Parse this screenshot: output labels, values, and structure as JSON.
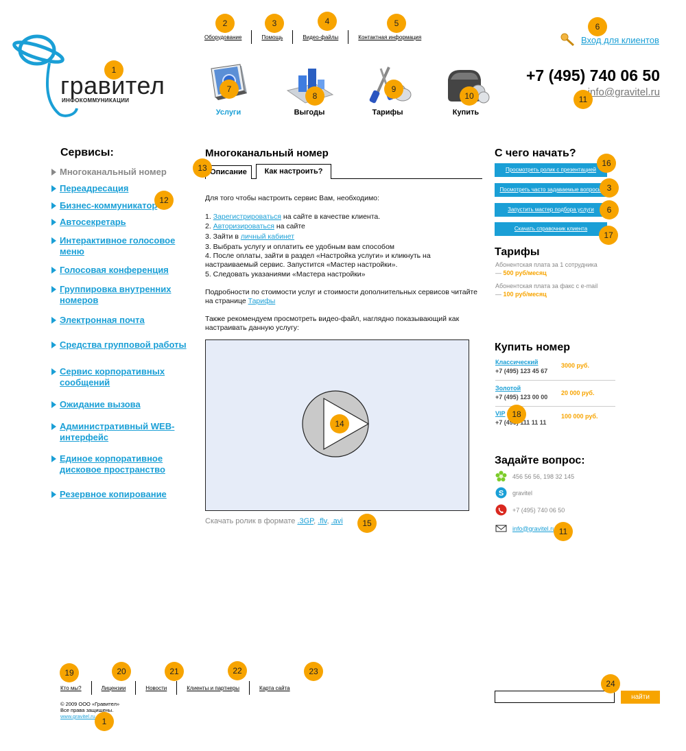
{
  "top_nav": [
    "Оборудование",
    "Помощь",
    "Видео-файлы",
    "Контактная информация"
  ],
  "logo": {
    "word": "гравител",
    "sub": "ИНФОКОММУНИКАЦИИ"
  },
  "login_label": "Вход для клиентов",
  "phone": "+7 (495) 740 06 50",
  "email_top": "info@gravitel.ru",
  "main_nav": [
    "Услуги",
    "Выгоды",
    "Тарифы",
    "Купить"
  ],
  "sidebar": {
    "title": "Сервисы:",
    "items": [
      "Многоканальный номер",
      "Переадресация",
      "Бизнес-коммуникатор",
      "Автосекретарь",
      "Интерактивное голосовое меню",
      "Голосовая конференция",
      "Группировка внутренних номеров",
      "Электронная почта",
      "Средства групповой работы",
      "Сервис корпоративных сообщений",
      "Ожидание вызова",
      "Административный WEB-интерфейс",
      "Единое корпоративное дисковое пространство",
      "Резервное копирование"
    ]
  },
  "main": {
    "title": "Многоканальный номер",
    "tabs": [
      "Описание",
      "Как настроить?"
    ],
    "intro": "Для того чтобы настроить сервис Вам, необходимо:",
    "step1_num": "1.",
    "step1_link": "Зарегистрироваться",
    "step1_rest": "на сайте в качестве клиента.",
    "step2_num": "2.",
    "step2_link": "Авторизироваться",
    "step2_rest": "на сайте",
    "step3_text": "3. Зайти в",
    "step3_link": "личный кабинет",
    "step4": "3. Выбрать услугу и оплатить ее удобным вам способом",
    "step5": "4. После оплаты, зайти в раздел «Настройка услуги» и кликнуть на настраиваемый сервис. Запустится «Мастер настройки».",
    "step6": "5. Следовать указаниями «Мастера настройки»",
    "details": "Подробности по стоимости услуг и стоимости дополнительных сервисов читайте на странице",
    "details_link": "Тарифы",
    "video_text": "Также рекомендуем просмотреть видео-файл, наглядно показывающий как настраивать данную услугу:",
    "download_label": "Скачать ролик в формате",
    "formats": [
      ".3GP",
      ".flv",
      ".avi"
    ]
  },
  "right": {
    "start_title": "С чего начать?",
    "start_buttons": [
      "Просмотреть ролик с презентацией",
      "Посмотреть часто задаваемые вопросы",
      "Запустить мастер подбора услуги",
      "Скачать справочник клиента"
    ],
    "tariffs_title": "Тарифы",
    "tariff1_label": "Абонентская плата за 1 сотрудника",
    "tariff1_dash": "—",
    "tariff1_price": "500 руб/месяц",
    "tariff2_label": "Абонентская плата за факс с e-mail",
    "tariff2_dash": "—",
    "tariff2_price": "100 руб/месяц",
    "buy_title": "Купить номер",
    "numbers": [
      {
        "name": "Классический",
        "phone": "+7 (495) 123 45 67",
        "price": "3000 руб."
      },
      {
        "name": "Золотой",
        "phone": "+7 (495) 123 00 00",
        "price": "20 000 руб."
      },
      {
        "name": "VIP",
        "phone": "+7 (495) 111 11 11",
        "price": "100 000 руб."
      }
    ],
    "ask_title": "Задайте вопрос:",
    "icq": "456 56 56, 198 32 145",
    "skype": "gravitel",
    "phone": "+7 (495) 740 06 50",
    "email": "info@gravitel.ru"
  },
  "footer": {
    "nav": [
      "Кто мы?",
      "Лицензии",
      "Новости",
      "Клиенты и партнеры",
      "Карта сайта"
    ],
    "copy1": "© 2009 ООО «Гравител»",
    "copy2": "Все права защищены.",
    "site": "www.gravitel.ru",
    "search_button": "найти"
  },
  "markers": [
    "1",
    "2",
    "3",
    "4",
    "5",
    "6",
    "7",
    "8",
    "9",
    "10",
    "11",
    "12",
    "13",
    "14",
    "15",
    "16",
    "3",
    "6",
    "17",
    "18",
    "11",
    "19",
    "20",
    "21",
    "22",
    "23",
    "24",
    "1"
  ],
  "colors": {
    "accent": "#1a9fd6",
    "marker": "#f7a400",
    "video_bg": "#e6ecf8"
  }
}
